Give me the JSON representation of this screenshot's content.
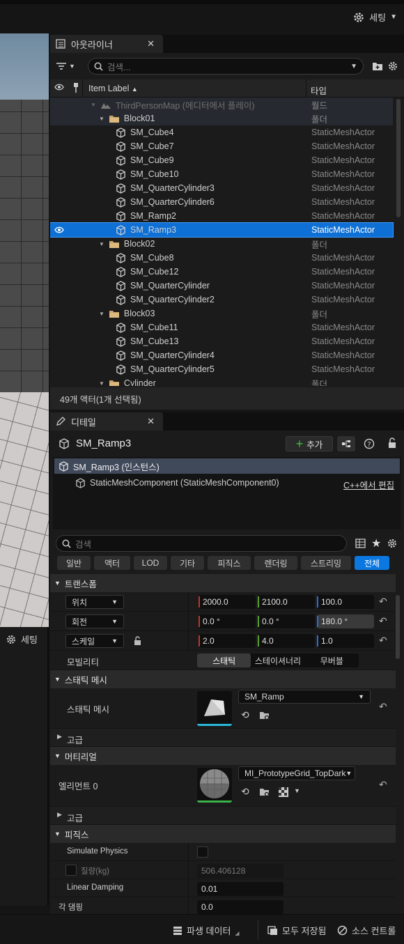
{
  "top": {
    "settings_label": "세팅"
  },
  "viewport": {
    "settings_label": "세팅"
  },
  "outliner": {
    "tab_title": "아웃라이너",
    "search_placeholder": "검색...",
    "col_label": "Item Label",
    "col_type": "타입",
    "rows": [
      {
        "label": "ThirdPersonMap (에디터에서 플레이)",
        "type": "월드",
        "kind": "world",
        "indent": 0
      },
      {
        "label": "Block01",
        "type": "폴더",
        "kind": "folder",
        "indent": 1
      },
      {
        "label": "SM_Cube4",
        "type": "StaticMeshActor",
        "kind": "mesh",
        "indent": 2
      },
      {
        "label": "SM_Cube7",
        "type": "StaticMeshActor",
        "kind": "mesh",
        "indent": 2
      },
      {
        "label": "SM_Cube9",
        "type": "StaticMeshActor",
        "kind": "mesh",
        "indent": 2
      },
      {
        "label": "SM_Cube10",
        "type": "StaticMeshActor",
        "kind": "mesh",
        "indent": 2
      },
      {
        "label": "SM_QuarterCylinder3",
        "type": "StaticMeshActor",
        "kind": "mesh",
        "indent": 2
      },
      {
        "label": "SM_QuarterCylinder6",
        "type": "StaticMeshActor",
        "kind": "mesh",
        "indent": 2
      },
      {
        "label": "SM_Ramp2",
        "type": "StaticMeshActor",
        "kind": "mesh",
        "indent": 2
      },
      {
        "label": "SM_Ramp3",
        "type": "StaticMeshActor",
        "kind": "mesh",
        "indent": 2,
        "selected": true
      },
      {
        "label": "Block02",
        "type": "폴더",
        "kind": "folder",
        "indent": 1
      },
      {
        "label": "SM_Cube8",
        "type": "StaticMeshActor",
        "kind": "mesh",
        "indent": 2
      },
      {
        "label": "SM_Cube12",
        "type": "StaticMeshActor",
        "kind": "mesh",
        "indent": 2
      },
      {
        "label": "SM_QuarterCylinder",
        "type": "StaticMeshActor",
        "kind": "mesh",
        "indent": 2
      },
      {
        "label": "SM_QuarterCylinder2",
        "type": "StaticMeshActor",
        "kind": "mesh",
        "indent": 2
      },
      {
        "label": "Block03",
        "type": "폴더",
        "kind": "folder",
        "indent": 1
      },
      {
        "label": "SM_Cube11",
        "type": "StaticMeshActor",
        "kind": "mesh",
        "indent": 2
      },
      {
        "label": "SM_Cube13",
        "type": "StaticMeshActor",
        "kind": "mesh",
        "indent": 2
      },
      {
        "label": "SM_QuarterCylinder4",
        "type": "StaticMeshActor",
        "kind": "mesh",
        "indent": 2
      },
      {
        "label": "SM_QuarterCylinder5",
        "type": "StaticMeshActor",
        "kind": "mesh",
        "indent": 2
      },
      {
        "label": "Cylinder",
        "type": "폴더",
        "kind": "folder",
        "indent": 1
      }
    ],
    "status": "49개 액터(1개 선택됨)"
  },
  "details": {
    "tab_title": "디테일",
    "actor_name": "SM_Ramp3",
    "add_label": "추가",
    "instance_label": "SM_Ramp3 (인스턴스)",
    "component_label": "StaticMeshComponent (StaticMeshComponent0)",
    "edit_cpp_label": "C++에서 편집",
    "search_placeholder": "검색",
    "filters": [
      "일반",
      "액터",
      "LOD",
      "기타",
      "피직스",
      "렌더링",
      "스트리밍",
      "전체"
    ],
    "active_filter": "전체",
    "transform": {
      "header": "트랜스폼",
      "location_label": "위치",
      "location": [
        "2000.0",
        "2100.0",
        "100.0"
      ],
      "rotation_label": "회전",
      "rotation": [
        "0.0 °",
        "0.0 °",
        "180.0 °"
      ],
      "scale_label": "스케일",
      "scale": [
        "2.0",
        "4.0",
        "1.0"
      ],
      "mobility_label": "모빌리티",
      "mobility_options": [
        "스태틱",
        "스테이셔너리",
        "무버블"
      ],
      "mobility_selected": "스태틱"
    },
    "static_mesh": {
      "header": "스태틱 메시",
      "label": "스태틱 메시",
      "value": "SM_Ramp",
      "advanced": "고급"
    },
    "materials": {
      "header": "머티리얼",
      "element_label": "엘리먼트 0",
      "value": "MI_PrototypeGrid_TopDark",
      "advanced": "고급"
    },
    "physics": {
      "header": "피직스",
      "simulate_label": "Simulate Physics",
      "mass_label": "질량(kg)",
      "mass_value": "506.406128",
      "linear_damping_label": "Linear Damping",
      "linear_damping_value": "0.01",
      "angular_damping_label": "각 댐핑",
      "angular_damping_value": "0.0"
    }
  },
  "bottombar": {
    "derived_data": "파생 데이터",
    "save_all": "모두 저장됨",
    "source_control": "소스 컨트롤"
  },
  "colors": {
    "selection": "#0e6fd4",
    "accent_blue": "#0a78e0",
    "x_axis": "#c0362c",
    "y_axis": "#5a9e2f",
    "z_axis": "#2f6fd0"
  }
}
